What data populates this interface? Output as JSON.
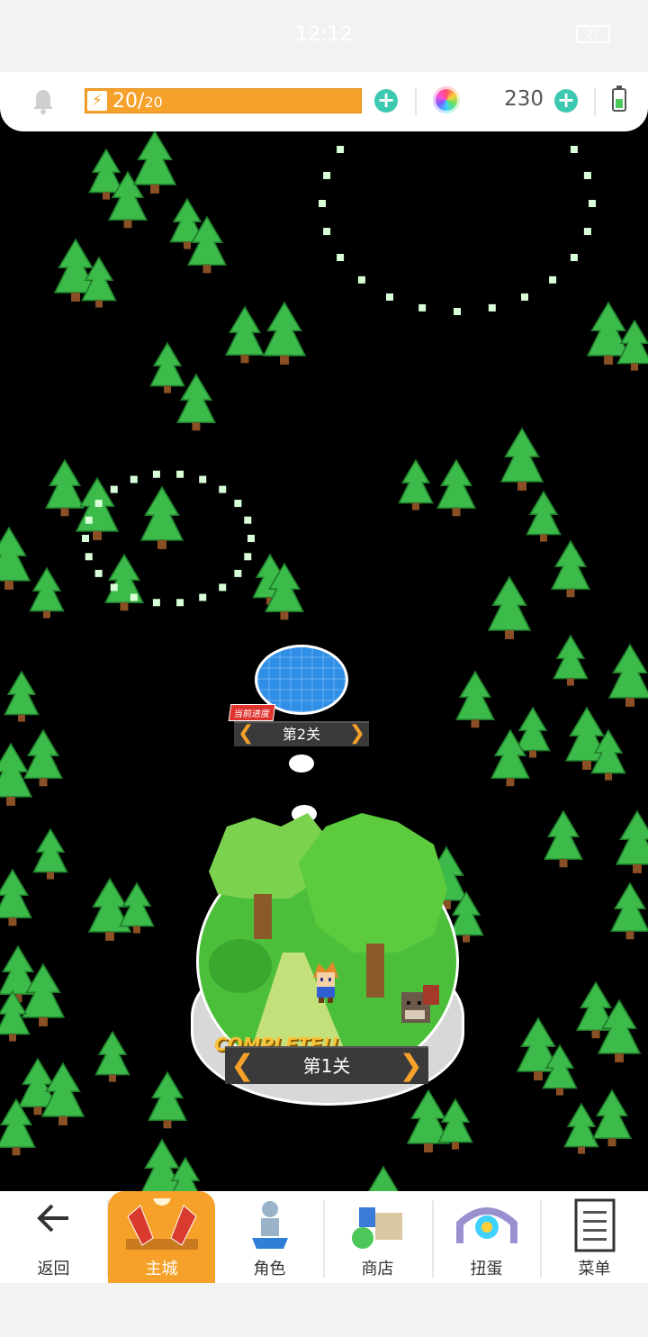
{
  "status_bar": {
    "time": "12:12",
    "battery": "27"
  },
  "top_bar": {
    "energy_current": "20",
    "energy_sep": "/",
    "energy_max": "20",
    "energy_fraction": 1.0,
    "gem_count": "230",
    "colors": {
      "energy": "#f6a12a",
      "plus": "#3dc9b0"
    }
  },
  "map": {
    "stage_2": {
      "badge": "当前进度",
      "label": "第2关"
    },
    "stage_1": {
      "status": "COMPLETE!!",
      "label": "第1关"
    }
  },
  "nav": [
    {
      "id": "back",
      "label": "返回",
      "icon": "back-arrow-icon"
    },
    {
      "id": "main-city",
      "label": "主城",
      "icon": "main-city-icon",
      "active": true
    },
    {
      "id": "character",
      "label": "角色",
      "icon": "character-icon"
    },
    {
      "id": "shop",
      "label": "商店",
      "icon": "shop-icon"
    },
    {
      "id": "gacha",
      "label": "扭蛋",
      "icon": "gacha-icon"
    },
    {
      "id": "menu",
      "label": "菜单",
      "icon": "menu-icon"
    }
  ]
}
